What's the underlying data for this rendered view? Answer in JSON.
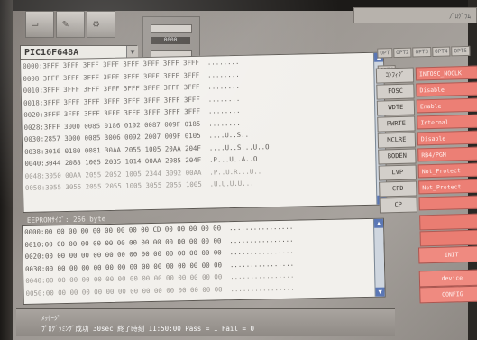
{
  "app": {
    "device": "PIC16F648A",
    "top_right_hint": "ﾌﾟﾛｸﾞﾗﾑ",
    "mini_value": "0000"
  },
  "program_memory": {
    "lines": [
      "0000:3FFF 3FFF 3FFF 3FFF 3FFF 3FFF 3FFF 3FFF  ........",
      "0008:3FFF 3FFF 3FFF 3FFF 3FFF 3FFF 3FFF 3FFF  ........",
      "0010:3FFF 3FFF 3FFF 3FFF 3FFF 3FFF 3FFF 3FFF  ........",
      "0018:3FFF 3FFF 3FFF 3FFF 3FFF 3FFF 3FFF 3FFF  ........",
      "0020:3FFF 3FFF 3FFF 3FFF 3FFF 3FFF 3FFF 3FFF  ........",
      "0028:3FFF 3000 0085 0186 0192 0087 009F 0185  ........",
      "0030:2857 3000 0085 3006 0092 2007 009F 0105  ....U..S..",
      "0038:3016 0180 0081 30AA 2055 1005 20AA 204F  ....U..S...U..O",
      "0040:3044 2088 1005 2035 1014 00AA 2085 204F  .P...U..A..O",
      "0048:3050 00AA 2055 2052 1005 2344 3092 00AA  .P..U.R...U..",
      "0050:3055 3055 2055 2055 1005 3055 2055 1005  .U.U.U.U..."
    ]
  },
  "eeprom": {
    "label": "EEPROMｻｲｽﾞ: 256 byte",
    "lines": [
      "0000:00 00 00 00 00 00 00 00 00 CD 00 00 00 00 00  ................",
      "0010:00 00 00 00 00 00 00 00 00 00 00 00 00 00 00  ................",
      "0020:00 00 00 00 00 00 00 00 00 00 00 00 00 00 00  ................",
      "0030:00 00 00 00 00 00 00 00 00 00 00 00 00 00 00  ................",
      "0040:00 00 00 00 00 00 00 00 00 00 00 00 00 00 00  ................",
      "0050:00 00 00 00 00 00 00 00 00 00 00 00 00 00 00  ................"
    ]
  },
  "config": {
    "tabs": [
      "OPT",
      "OPT2",
      "OPT3",
      "OPT4",
      "OPT5",
      "OPT6"
    ],
    "items": [
      {
        "key": "ｺﾝﾌｨｸﾞ",
        "value": "INTOSC_NOCLK"
      },
      {
        "key": "FOSC",
        "value": "Disable"
      },
      {
        "key": "WDTE",
        "value": "Enable"
      },
      {
        "key": "PWRTE",
        "value": "Internal"
      },
      {
        "key": "MCLRE",
        "value": "Disable"
      },
      {
        "key": "BODEN",
        "value": "RB4/PGM"
      },
      {
        "key": "LVP",
        "value": "Not_Protect"
      },
      {
        "key": "CPD",
        "value": "Not_Protect"
      },
      {
        "key": "CP",
        "value": ""
      }
    ],
    "buttons": [
      "INIT",
      "device",
      "CONFIG"
    ]
  },
  "status": {
    "title": "ﾒｯｾｰｼﾞ",
    "message": "ﾌﾟﾛｸﾞﾗﾐﾝｸﾞ成功 30sec  終了時刻 11:50:00  Pass = 1    Fail = 0"
  },
  "colors": {
    "config_value_bg": "#ec7f75",
    "scroll_arrow": "#5b77b5"
  }
}
